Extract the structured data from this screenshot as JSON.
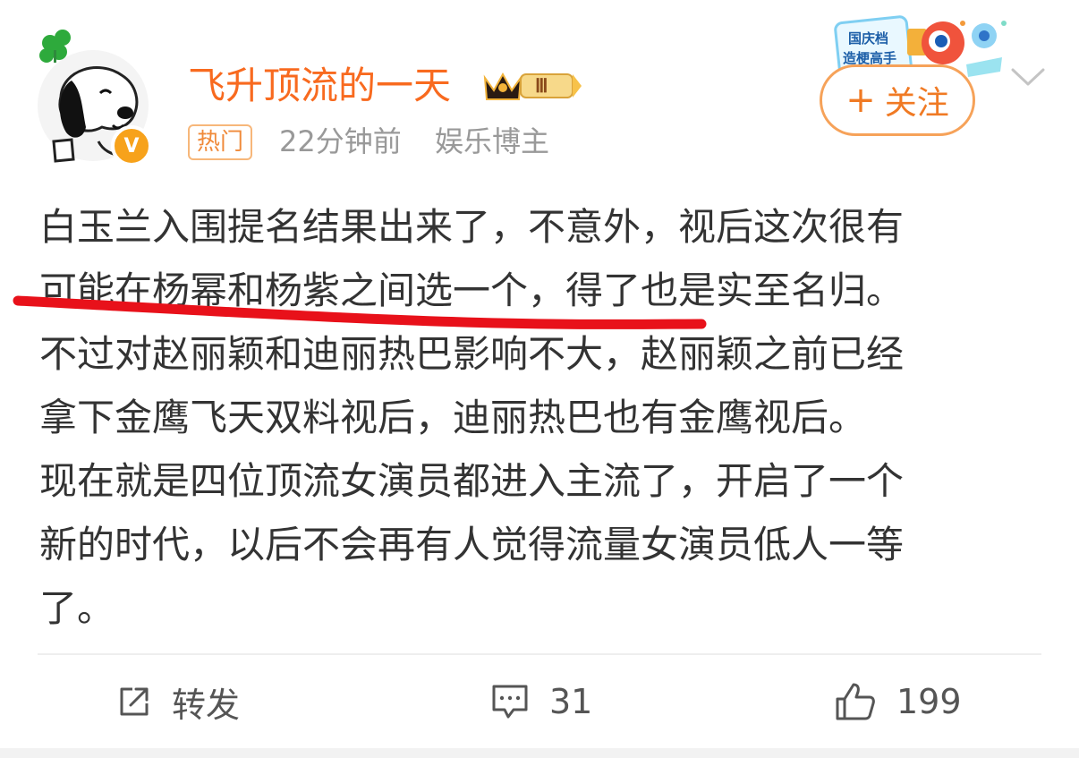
{
  "post": {
    "author": {
      "name": "飞升顶流的一天",
      "avatar_icon": "snoopy-avatar",
      "verified_icon": "verified-v-icon",
      "verified_label": "V",
      "level_badge": "Ⅲ",
      "tag": "热门",
      "time": "22分钟前",
      "category": "娱乐博主"
    },
    "follow_label": "关注",
    "follow_plus": "+",
    "holiday_badge": {
      "line1": "国庆档",
      "line2": "造梗高手"
    },
    "text_lines": [
      "白玉兰入围提名结果出来了，不意外，视后这次很有",
      "可能在杨幂和杨紫之间选一个，得了也是实至名归。",
      "不过对赵丽颖和迪丽热巴影响不大，赵丽颖之前已经",
      "拿下金鹰飞天双料视后，迪丽热巴也有金鹰视后。",
      "现在就是四位顶流女演员都进入主流了，开启了一个",
      "新的时代，以后不会再有人觉得流量女演员低人一等",
      "了。"
    ],
    "annotation_color": "#e8111a",
    "actions": {
      "repost_label": "转发",
      "comment_count": "31",
      "like_count": "199"
    }
  },
  "colors": {
    "username": "#f86a1f",
    "accent": "#f7a21b",
    "meta": "#999999",
    "text": "#333333"
  }
}
